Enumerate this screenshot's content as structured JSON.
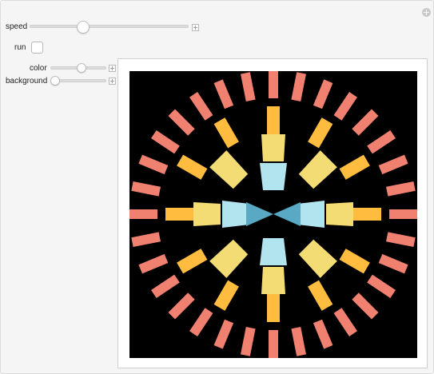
{
  "controls": {
    "speed": {
      "label": "speed",
      "value": 0.33
    },
    "run": {
      "label": "run",
      "checked": false
    },
    "color": {
      "label": "color",
      "value": 0.55
    },
    "background": {
      "label": "background",
      "value": 0.0
    }
  },
  "visual": {
    "background_color": "#000000",
    "ring_colors": [
      "#B2E4F0",
      "#F3DC74",
      "#FFBC3E",
      "#F08070"
    ],
    "center_color": "#59A8C4"
  }
}
